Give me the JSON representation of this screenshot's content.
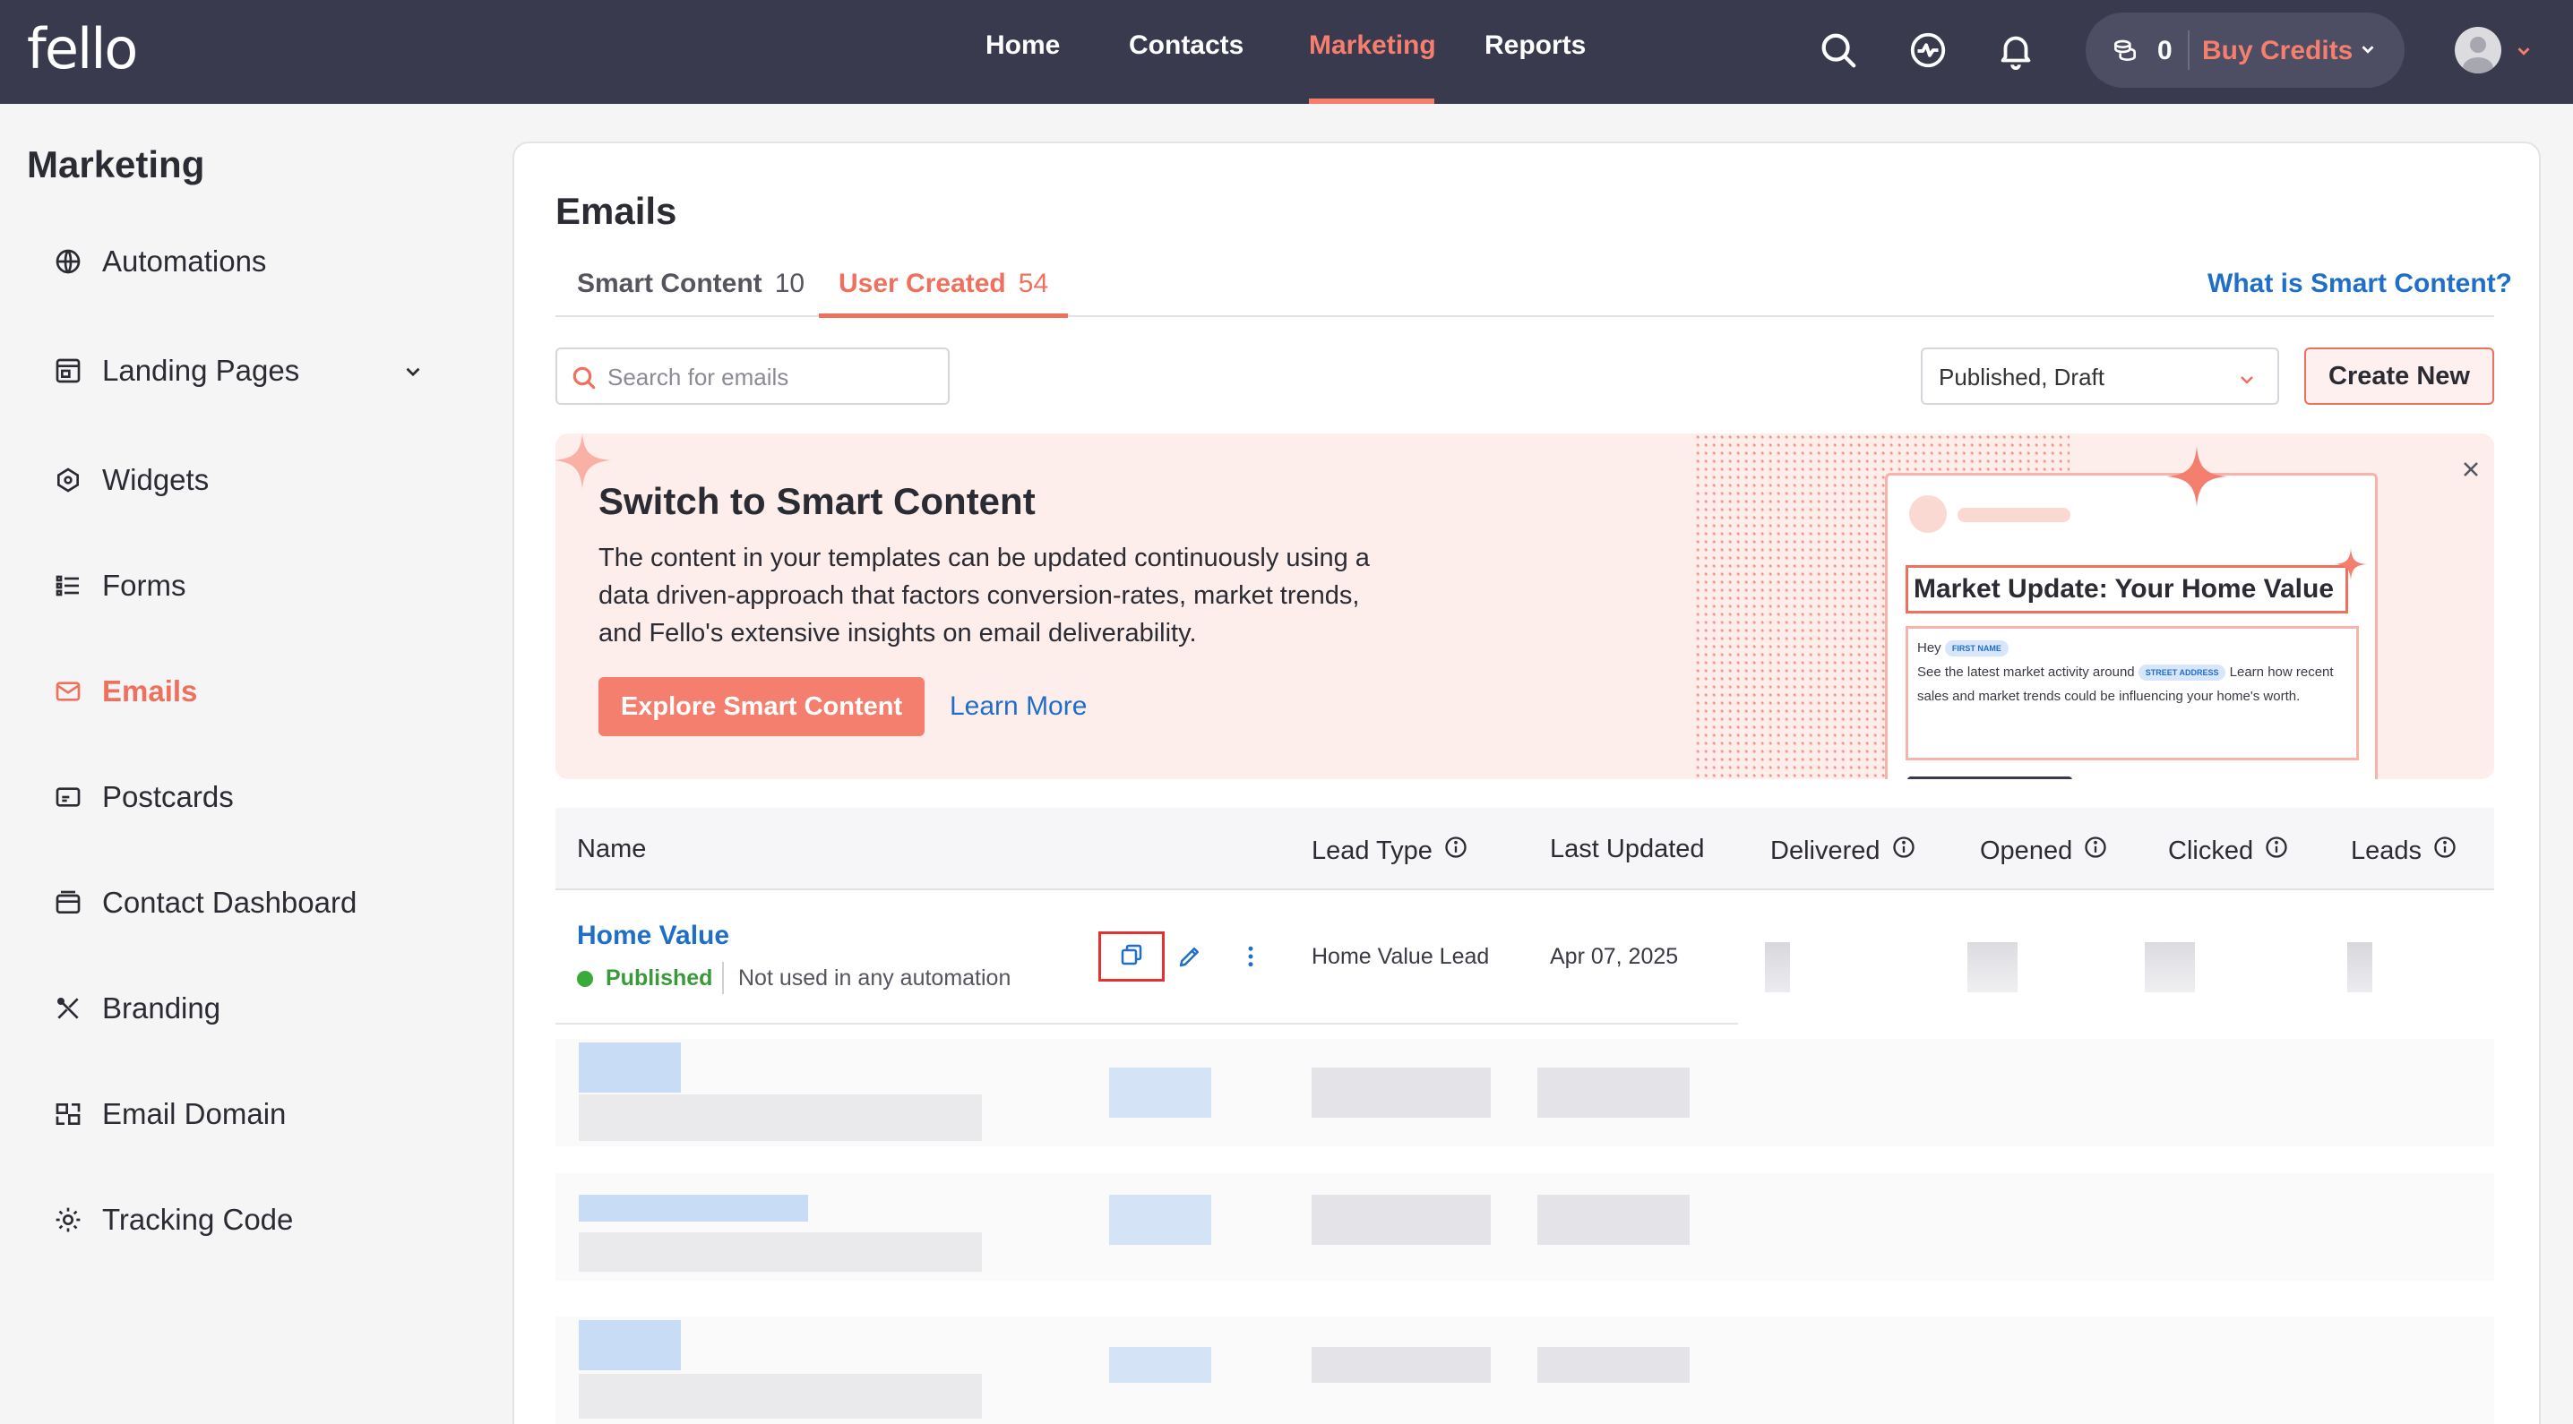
{
  "brand": {
    "logo_text": "fello",
    "accent_color": "#f47f6e",
    "nav_bg": "#3a3a4f"
  },
  "nav": {
    "links": [
      {
        "label": "Home",
        "active": false
      },
      {
        "label": "Contacts",
        "active": false
      },
      {
        "label": "Marketing",
        "active": true
      },
      {
        "label": "Reports",
        "active": false
      }
    ],
    "icons": [
      "search-icon",
      "activity-icon",
      "bell-icon"
    ],
    "credits": {
      "count": "0",
      "buy_label": "Buy Credits"
    }
  },
  "sidebar": {
    "title": "Marketing",
    "items": [
      {
        "label": "Automations",
        "icon": "globe-icon",
        "active": false
      },
      {
        "label": "Landing Pages",
        "icon": "landing-page-icon",
        "active": false,
        "expandable": true
      },
      {
        "label": "Widgets",
        "icon": "widget-icon",
        "active": false
      },
      {
        "label": "Forms",
        "icon": "list-icon",
        "active": false
      },
      {
        "label": "Emails",
        "icon": "mail-icon",
        "active": true
      },
      {
        "label": "Postcards",
        "icon": "postcard-icon",
        "active": false
      },
      {
        "label": "Contact Dashboard",
        "icon": "dashboard-icon",
        "active": false
      },
      {
        "label": "Branding",
        "icon": "branding-icon",
        "active": false
      },
      {
        "label": "Email Domain",
        "icon": "domain-icon",
        "active": false
      },
      {
        "label": "Tracking Code",
        "icon": "gear-icon",
        "active": false
      }
    ]
  },
  "main": {
    "title": "Emails",
    "tabs": [
      {
        "label": "Smart Content",
        "count": "10",
        "active": false
      },
      {
        "label": "User Created",
        "count": "54",
        "active": true
      }
    ],
    "smart_link": "What is Smart Content?",
    "search": {
      "placeholder": "Search for emails",
      "value": ""
    },
    "status_filter": "Published, Draft",
    "create_label": "Create New"
  },
  "banner": {
    "title": "Switch to Smart Content",
    "text": "The content in your templates can be updated continuously using a data driven-approach that factors conversion-rates, market trends, and Fello's extensive insights on email deliverability.",
    "explore_label": "Explore Smart Content",
    "learn_label": "Learn More",
    "preview": {
      "headline": "Market Update: Your Home Value",
      "greeting": "Hey",
      "chip_first_name": "FIRST NAME",
      "body_prefix": "See the latest market activity around",
      "chip_street": "STREET ADDRESS",
      "body_suffix": "Learn how recent sales and market trends could be influencing your home's worth."
    }
  },
  "table": {
    "columns": [
      {
        "label": "Name",
        "info": false
      },
      {
        "label": "Lead Type",
        "info": true
      },
      {
        "label": "Last Updated",
        "info": false
      },
      {
        "label": "Delivered",
        "info": true
      },
      {
        "label": "Opened",
        "info": true
      },
      {
        "label": "Clicked",
        "info": true
      },
      {
        "label": "Leads",
        "info": true
      }
    ],
    "rows": [
      {
        "name": "Home Value",
        "status": "Published",
        "automation": "Not used in any automation",
        "lead_type": "Home Value Lead",
        "last_updated": "Apr 07, 2025"
      }
    ]
  }
}
